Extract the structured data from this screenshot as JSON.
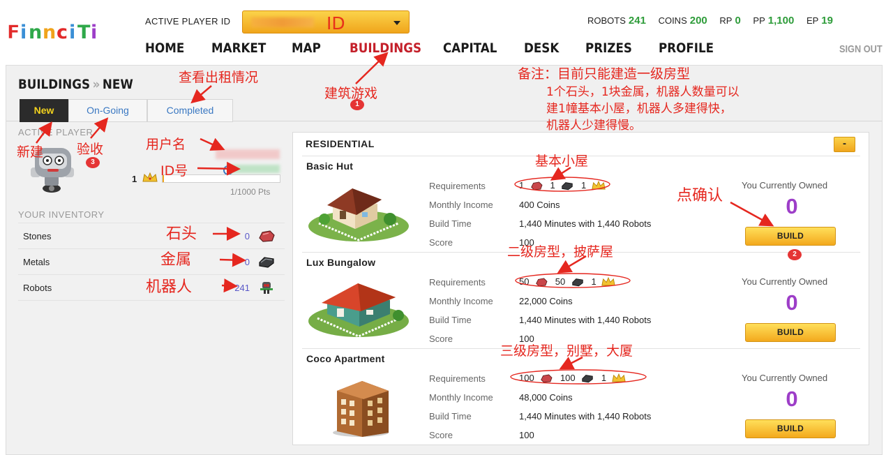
{
  "app": {
    "logo_text": "Finnciti",
    "active_player_label": "ACTIVE PLAYER ID",
    "id_select_value": "ID",
    "sign_out_label": "SIGN OUT"
  },
  "stats": [
    {
      "label": "ROBOTS",
      "value": "241"
    },
    {
      "label": "COINS",
      "value": "200"
    },
    {
      "label": "RP",
      "value": "0"
    },
    {
      "label": "PP",
      "value": "1,100"
    },
    {
      "label": "EP",
      "value": "19"
    }
  ],
  "nav": [
    {
      "label": "HOME",
      "active": false
    },
    {
      "label": "MARKET",
      "active": false
    },
    {
      "label": "MAP",
      "active": false
    },
    {
      "label": "BUILDINGS",
      "active": true
    },
    {
      "label": "CAPITAL",
      "active": false
    },
    {
      "label": "DESK",
      "active": false
    },
    {
      "label": "PRIZES",
      "active": false
    },
    {
      "label": "PROFILE",
      "active": false
    }
  ],
  "breadcrumb": {
    "section": "BUILDINGS",
    "separator": "»",
    "page": "NEW"
  },
  "tabs": [
    {
      "label": "New",
      "active": true
    },
    {
      "label": "On-Going",
      "active": false
    },
    {
      "label": "Completed",
      "active": false
    }
  ],
  "player": {
    "active_player_label": "ACTIVE PLAYER",
    "level": "1",
    "xp_text": "1/1000 Pts",
    "xp_fraction": 0.001
  },
  "inventory": {
    "title": "YOUR INVENTORY",
    "items": [
      {
        "name": "Stones",
        "value": "0",
        "icon": "stone-icon"
      },
      {
        "name": "Metals",
        "value": "0",
        "icon": "metal-icon"
      },
      {
        "name": "Robots",
        "value": "241",
        "icon": "robot-icon"
      }
    ]
  },
  "residential": {
    "title": "RESIDENTIAL",
    "collapse_label": "-",
    "labels": {
      "requirements": "Requirements",
      "monthly_income": "Monthly Income",
      "build_time": "Build Time",
      "score": "Score",
      "owned": "You Currently Owned",
      "build_button": "BUILD"
    },
    "buildings": [
      {
        "name": "Basic Hut",
        "stones": "1",
        "metals": "1",
        "level": "1",
        "income": "400 Coins",
        "build_time": "1,440 Minutes with 1,440 Robots",
        "score": "100",
        "owned": "0"
      },
      {
        "name": "Lux Bungalow",
        "stones": "50",
        "metals": "50",
        "level": "1",
        "income": "22,000 Coins",
        "build_time": "1,440 Minutes with 1,440 Robots",
        "score": "100",
        "owned": "0"
      },
      {
        "name": "Coco Apartment",
        "stones": "100",
        "metals": "100",
        "level": "1",
        "income": "48,000 Coins",
        "build_time": "1,440 Minutes with 1,440 Robots",
        "score": "100",
        "owned": "0"
      }
    ]
  },
  "annotations": {
    "rental_status": "查看出租情况",
    "building_game": "建筑游戏",
    "note_title": "备注：目前只能建造一级房型",
    "note_line1": "1个石头，1块金属，机器人数量可以",
    "note_line2": "建1幢基本小屋，机器人多建得快，",
    "note_line3": "机器人少建得慢。",
    "new_build": "新建",
    "inspect": "验收",
    "username": "用户名",
    "id_no": "ID号",
    "stone": "石头",
    "metal": "金属",
    "robot": "机器人",
    "basic_hut": "基本小屋",
    "confirm": "点确认",
    "level2": "二级房型，披萨屋",
    "level3": "三级房型，别墅，大厦",
    "badge1": "1",
    "badge2": "2",
    "badge3": "3"
  },
  "colors": {
    "accent_red": "#c4202a",
    "stat_green": "#2e9c3a",
    "owned_purple": "#9d3ec8",
    "button_gold": "#f3a91d",
    "annotation_red": "#e5271f"
  }
}
